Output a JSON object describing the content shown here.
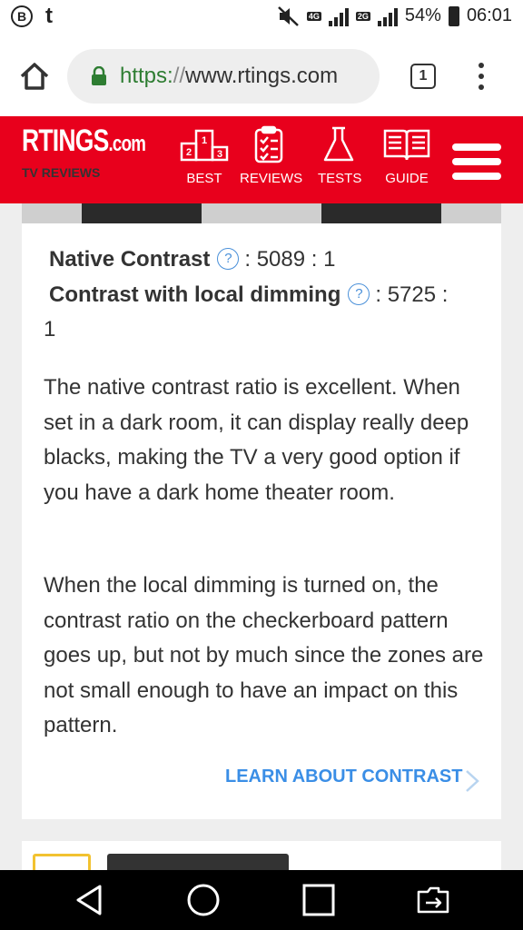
{
  "status_bar": {
    "left_icons": [
      "b-circle-icon",
      "tumblr-icon"
    ],
    "network_labels": [
      "4G",
      "4G",
      "2G"
    ],
    "battery": "54%",
    "time": "06:01"
  },
  "browser": {
    "url_scheme": "https:",
    "url_sep": "//",
    "url_host": "www.rtings.com",
    "tab_count": "1"
  },
  "site_header": {
    "logo": "RTINGS",
    "logo_suffix": ".com",
    "subtitle": "TV REVIEWS",
    "nav": [
      {
        "label": "BEST",
        "icon": "podium-icon"
      },
      {
        "label": "REVIEWS",
        "icon": "clipboard-icon"
      },
      {
        "label": "TESTS",
        "icon": "flask-icon"
      },
      {
        "label": "GUIDE",
        "icon": "book-icon"
      }
    ]
  },
  "contrast": {
    "native_label": "Native Contrast",
    "native_value": ": 5089 : 1",
    "local_label": "Contrast with local dimming",
    "local_value": ": 5725 :",
    "local_value_cont": "1",
    "help_glyph": "?",
    "paragraph1": "The native contrast ratio is excellent. When set in a dark room, it can display really deep blacks, making the TV a very good option if you have a dark home theater room.",
    "paragraph2": "When the local dimming is turned on, the contrast ratio on the checkerboard pattern goes up, but not by much since the zones are not small enough to have an impact on this pattern.",
    "learn_link": "LEARN ABOUT CONTRAST"
  },
  "colors": {
    "header_red": "#e8001c",
    "link_blue": "#3a8ee6",
    "text": "#333333"
  }
}
